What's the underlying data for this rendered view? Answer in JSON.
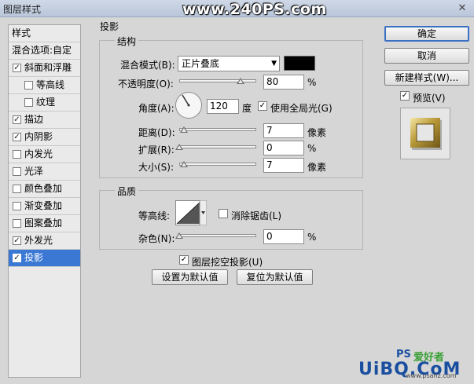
{
  "window": {
    "title": "图层样式",
    "watermark": "www.240PS.com"
  },
  "styles_list": {
    "header": "样式",
    "blend_options": "混合选项:自定",
    "items": [
      {
        "label": "斜面和浮雕",
        "checked": true,
        "indent": false
      },
      {
        "label": "等高线",
        "checked": false,
        "indent": true
      },
      {
        "label": "纹理",
        "checked": false,
        "indent": true
      },
      {
        "label": "描边",
        "checked": true,
        "indent": false
      },
      {
        "label": "内阴影",
        "checked": true,
        "indent": false
      },
      {
        "label": "内发光",
        "checked": false,
        "indent": false
      },
      {
        "label": "光泽",
        "checked": false,
        "indent": false
      },
      {
        "label": "颜色叠加",
        "checked": false,
        "indent": false
      },
      {
        "label": "渐变叠加",
        "checked": false,
        "indent": false
      },
      {
        "label": "图案叠加",
        "checked": false,
        "indent": false
      },
      {
        "label": "外发光",
        "checked": true,
        "indent": false
      },
      {
        "label": "投影",
        "checked": true,
        "indent": false,
        "selected": true
      }
    ]
  },
  "drop_shadow": {
    "title": "投影",
    "structure": {
      "title": "结构",
      "blend_mode_label": "混合模式(B):",
      "blend_mode_value": "正片叠底",
      "shadow_color": "#000000",
      "opacity_label": "不透明度(O):",
      "opacity_value": "80",
      "percent": "%",
      "angle_label": "角度(A):",
      "angle_value": "120",
      "degree": "度",
      "global_light_label": "使用全局光(G)",
      "global_light_checked": true,
      "distance_label": "距离(D):",
      "distance_value": "7",
      "pixels": "像素",
      "spread_label": "扩展(R):",
      "spread_value": "0",
      "size_label": "大小(S):",
      "size_value": "7"
    },
    "quality": {
      "title": "品质",
      "contour_label": "等高线:",
      "anti_alias_label": "消除锯齿(L)",
      "anti_alias_checked": false,
      "noise_label": "杂色(N):",
      "noise_value": "0"
    },
    "knockout_label": "图层挖空投影(U)",
    "knockout_checked": true,
    "make_default": "设置为默认值",
    "reset_default": "复位为默认值"
  },
  "actions": {
    "ok": "确定",
    "cancel": "取消",
    "new_style": "新建样式(W)...",
    "preview_label": "预览(V)",
    "preview_checked": true
  },
  "brand": {
    "ps_text": "PS",
    "cn_text": "爱好者",
    "site": "UiBQ.CoM",
    "small": "www.psahz.com"
  },
  "colors": {
    "selection": "#3a78d4",
    "brand_blue": "#1a4fa0",
    "brand_green": "#3aa035"
  }
}
